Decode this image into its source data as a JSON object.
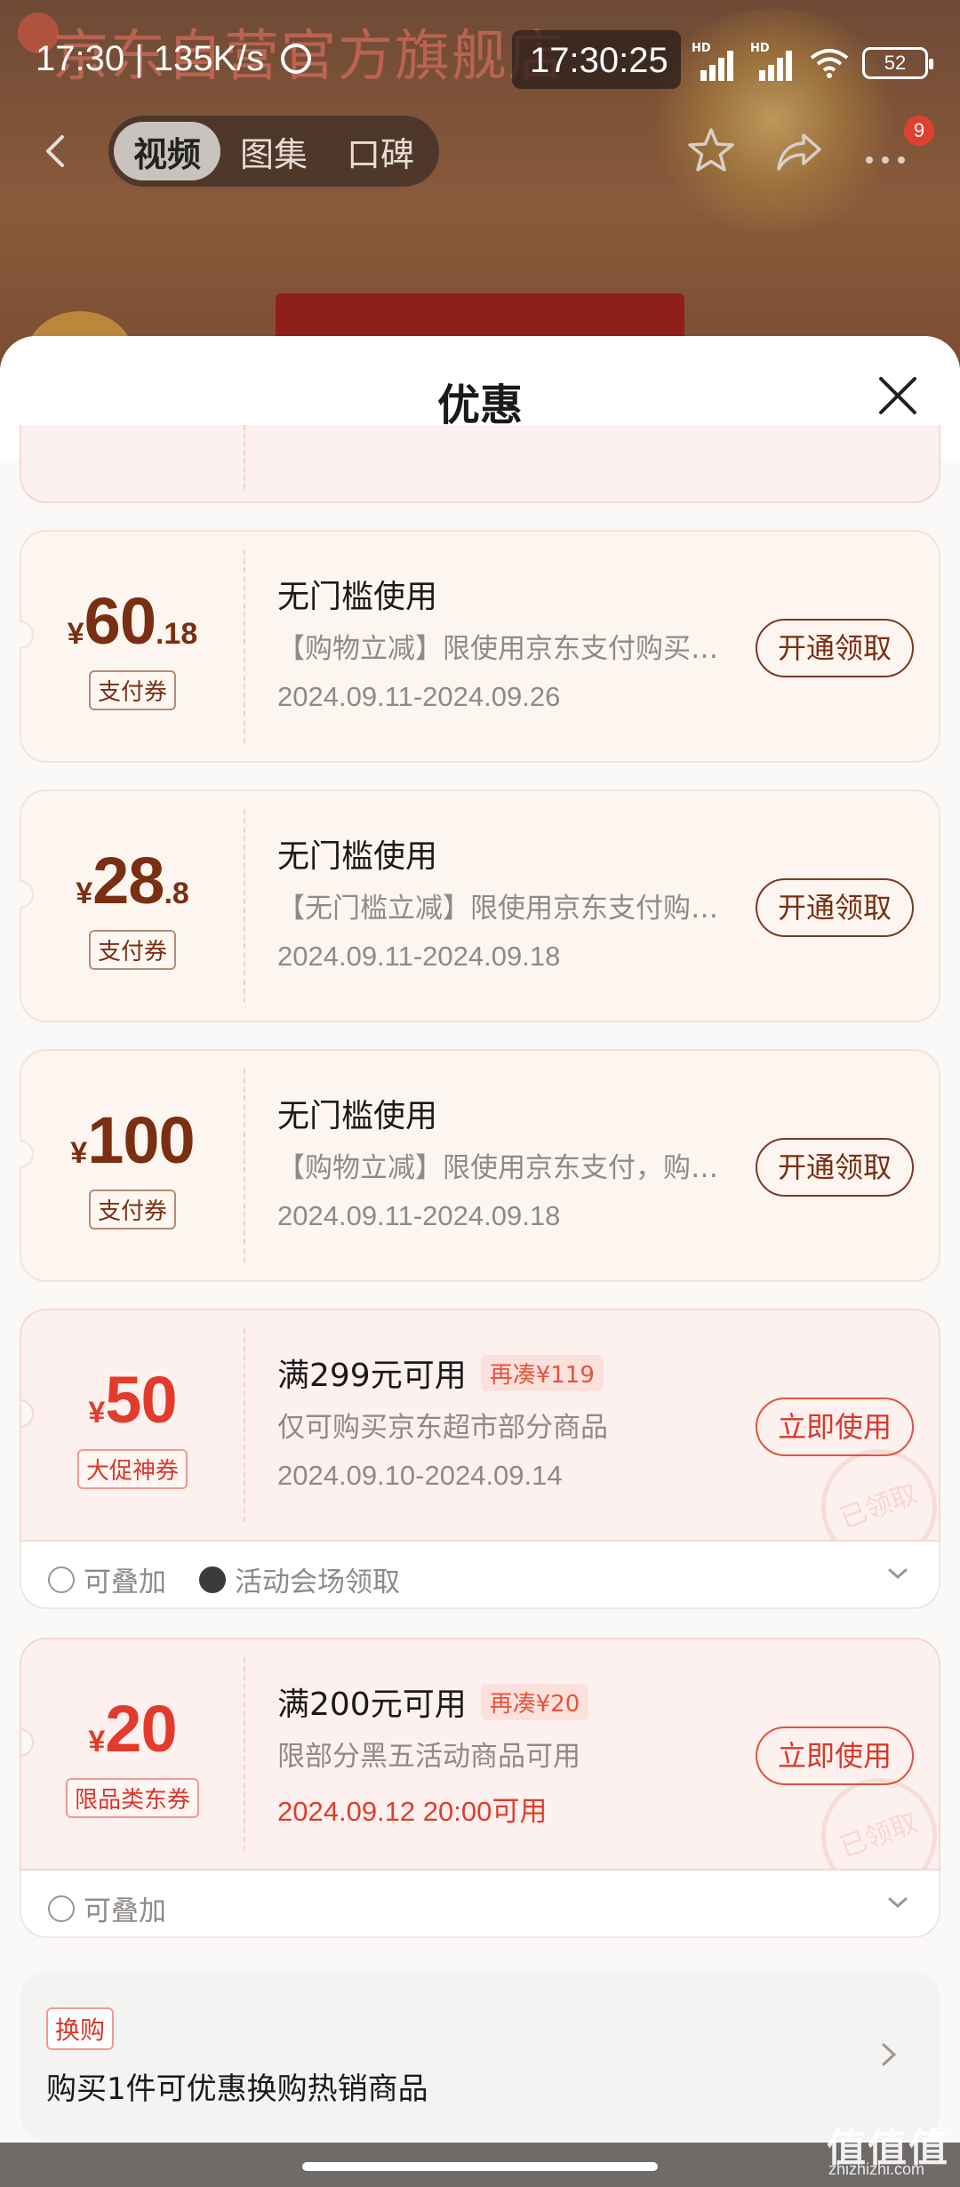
{
  "background": {
    "store_title": "京东自营官方旗舰店"
  },
  "status_bar": {
    "time": "17:30",
    "net_speed": "135K/s",
    "clock_overlay": "17:30:25",
    "hd_label": "HD",
    "battery": "52"
  },
  "nav": {
    "tabs": [
      {
        "label": "视频",
        "active": true
      },
      {
        "label": "图集",
        "active": false
      },
      {
        "label": "口碑",
        "active": false
      }
    ],
    "badge_count": "9"
  },
  "sheet": {
    "title": "优惠"
  },
  "coupons": [
    {
      "currency": "¥",
      "amount_int": "60",
      "amount_dec": ".18",
      "tag": "支付券",
      "title": "无门槛使用",
      "desc": "【购物立减】限使用京东支付购买指定商品",
      "date": "2024.09.11-2024.09.26",
      "button": "开通领取"
    },
    {
      "currency": "¥",
      "amount_int": "28",
      "amount_dec": ".8",
      "tag": "支付券",
      "title": "无门槛使用",
      "desc": "【无门槛立减】限使用京东支付购买指定商品",
      "date": "2024.09.11-2024.09.18",
      "button": "开通领取"
    },
    {
      "currency": "¥",
      "amount_int": "100",
      "amount_dec": "",
      "tag": "支付券",
      "title": "无门槛使用",
      "desc": "【购物立减】限使用京东支付，购买指定商品",
      "date": "2024.09.11-2024.09.18",
      "button": "开通领取"
    },
    {
      "currency": "¥",
      "amount_int": "50",
      "amount_dec": "",
      "tag": "大促神券",
      "title": "满299元可用",
      "pill": "再凑¥119",
      "desc": "仅可购买京东超市部分商品",
      "date": "2024.09.10-2024.09.14",
      "button": "立即使用",
      "stamp": "已领取",
      "foot": [
        "可叠加",
        "活动会场领取"
      ]
    },
    {
      "currency": "¥",
      "amount_int": "20",
      "amount_dec": "",
      "tag": "限品类东券",
      "title": "满200元可用",
      "pill": "再凑¥20",
      "desc": "限部分黑五活动商品可用",
      "date": "2024.09.12 20:00可用",
      "button": "立即使用",
      "stamp": "已领取",
      "foot": [
        "可叠加"
      ]
    }
  ],
  "exchange": {
    "tag": "换购",
    "text": "购买1件可优惠换购热销商品"
  },
  "watermark": {
    "main": "值值值",
    "sub": "zhizhizhi.com"
  },
  "colors": {
    "brown_accent": "#7a2e12",
    "red_accent": "#e23b2b",
    "sheet_bg": "#fbf9f7"
  }
}
